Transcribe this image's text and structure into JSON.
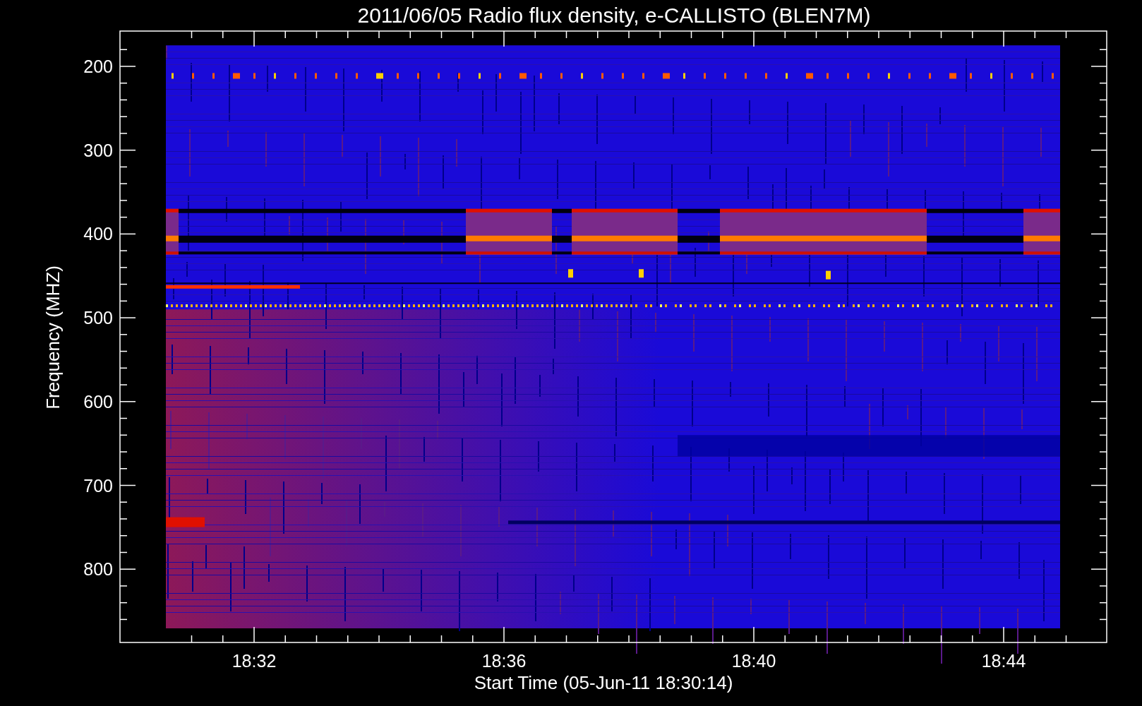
{
  "plot": {
    "title": "2011/06/05  Radio flux density, e-CALLISTO (BLEN7M)",
    "ylabel": "Frequency (MHZ)",
    "xlabel": "Start Time (05-Jun-11 18:30:14)",
    "yticks": [
      "200",
      "300",
      "400",
      "500",
      "600",
      "700",
      "800"
    ],
    "xticks": [
      "18:32",
      "18:36",
      "18:40",
      "18:44"
    ]
  }
}
